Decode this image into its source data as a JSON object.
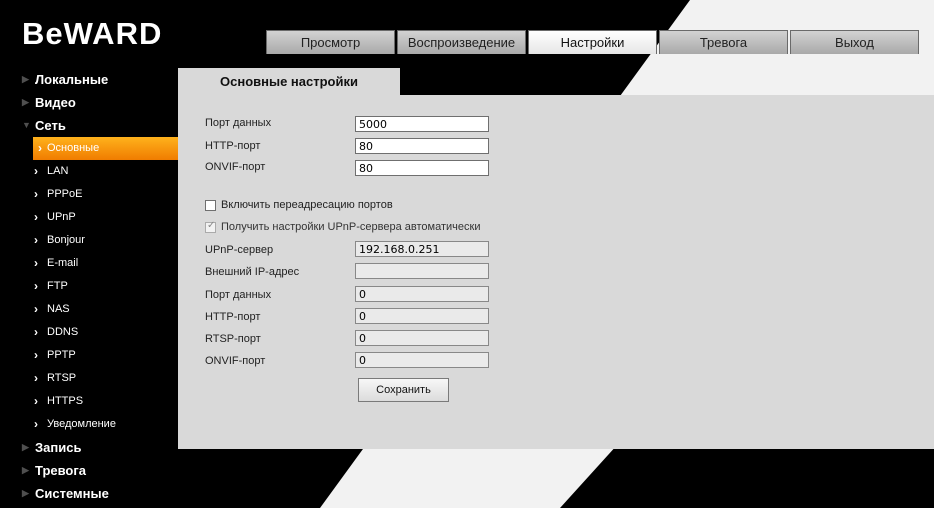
{
  "brand": {
    "logo_text": "BeWARD"
  },
  "tabs": [
    {
      "label": "Просмотр"
    },
    {
      "label": "Воспроизведение"
    },
    {
      "label": "Настройки",
      "active": true
    },
    {
      "label": "Тревога"
    },
    {
      "label": "Выход"
    }
  ],
  "sidebar": {
    "groups": [
      {
        "label": "Локальные"
      },
      {
        "label": "Видео"
      },
      {
        "label": "Сеть",
        "expanded": true
      },
      {
        "label": "Запись"
      },
      {
        "label": "Тревога"
      },
      {
        "label": "Системные"
      }
    ],
    "network_items": [
      {
        "label": "Основные",
        "active": true
      },
      {
        "label": "LAN"
      },
      {
        "label": "PPPoE"
      },
      {
        "label": "UPnP"
      },
      {
        "label": "Bonjour"
      },
      {
        "label": "E-mail"
      },
      {
        "label": "FTP"
      },
      {
        "label": "NAS"
      },
      {
        "label": "DDNS"
      },
      {
        "label": "PPTP"
      },
      {
        "label": "RTSP"
      },
      {
        "label": "HTTPS"
      },
      {
        "label": "Уведомление"
      }
    ]
  },
  "content": {
    "tab_title": "Основные настройки",
    "data_port_label": "Порт данных",
    "data_port_value": "5000",
    "http_port_label": "HTTP-порт",
    "http_port_value": "80",
    "onvif_port_label": "ONVIF-порт",
    "onvif_port_value": "80",
    "port_forwarding_label": "Включить переадресацию портов",
    "port_forwarding_checked": false,
    "upnp_auto_label": "Получить настройки UPnP-сервера автоматически",
    "upnp_auto_checked": true,
    "upnp_server_label": "UPnP-сервер",
    "upnp_server_value": "192.168.0.251",
    "external_ip_label": "Внешний IP-адрес",
    "external_ip_value": "",
    "ext_data_port_label": "Порт данных",
    "ext_data_port_value": "0",
    "ext_http_port_label": "HTTP-порт",
    "ext_http_port_value": "0",
    "ext_rtsp_port_label": "RTSP-порт",
    "ext_rtsp_port_value": "0",
    "ext_onvif_port_label": "ONVIF-порт",
    "ext_onvif_port_value": "0",
    "save_label": "Сохранить"
  },
  "colors": {
    "background": "#000000",
    "panel": "#d9d9d9",
    "accent_active": "#f08a00",
    "watermark_stripe": "#ffffff"
  }
}
